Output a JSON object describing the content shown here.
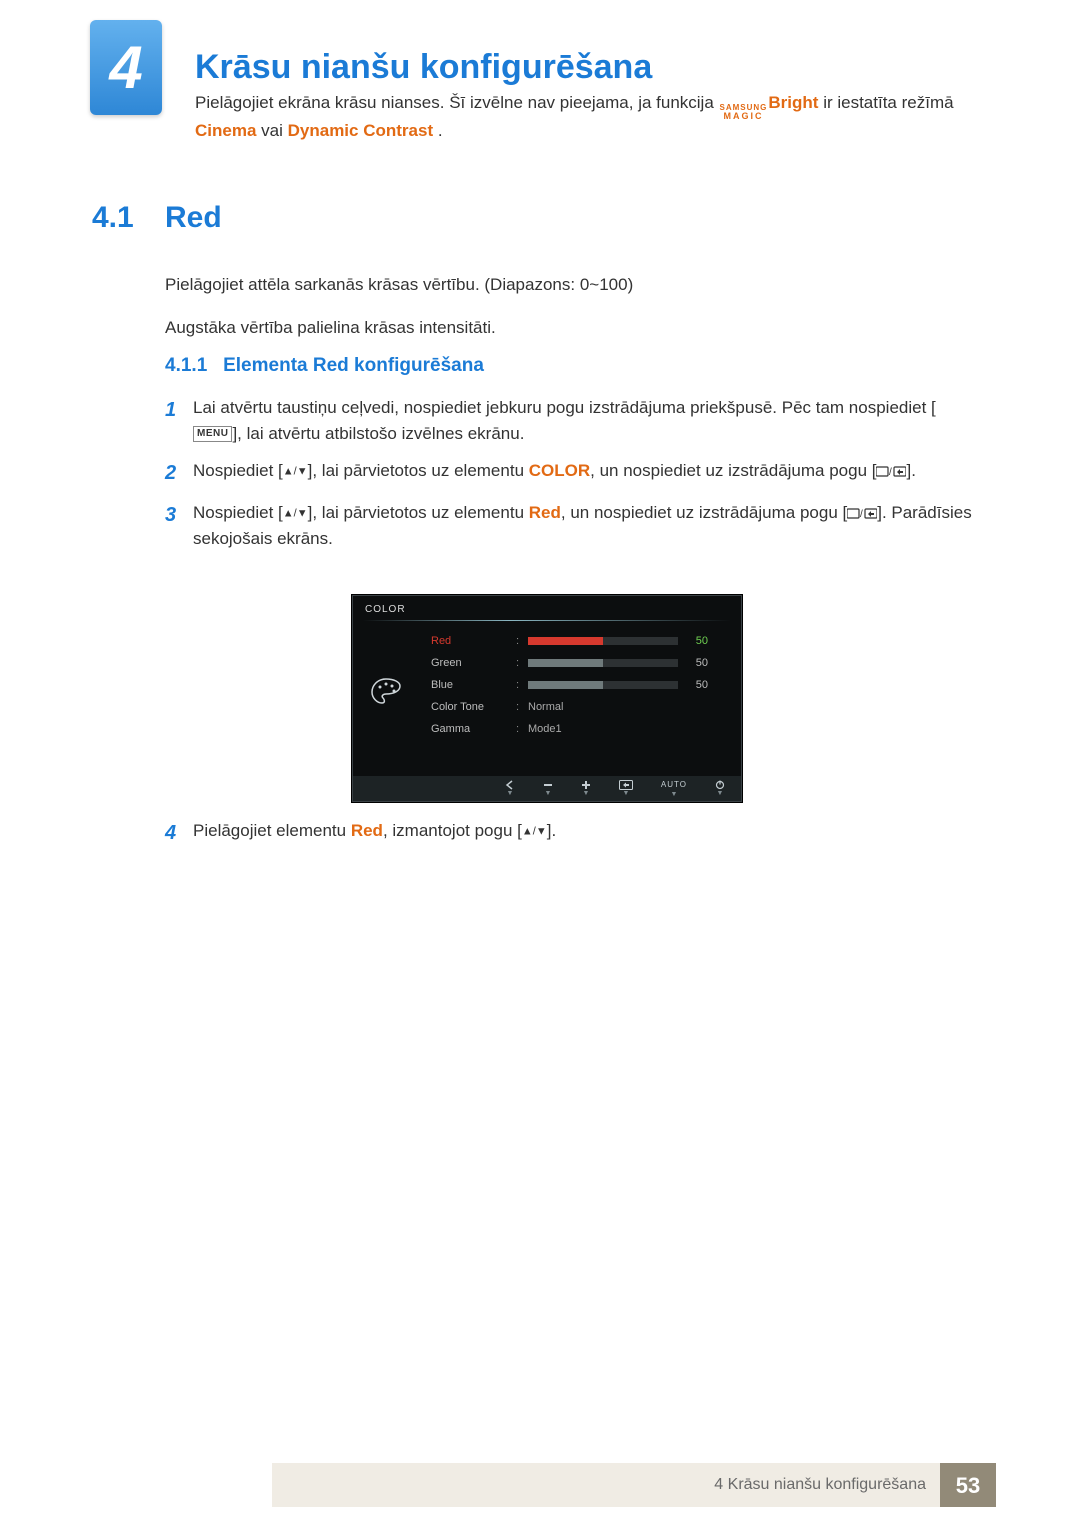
{
  "chapter": {
    "number": "4",
    "title": "Krāsu nianšu konfigurēšana"
  },
  "intro": {
    "p1a": "Pielāgojiet ekrāna krāsu nianses. Šī izvēlne nav pieejama, ja funkcija ",
    "samsung": "SAMSUNG",
    "magic": "MAGIC",
    "bright": "Bright",
    "p1b": " ir iestatīta režīmā ",
    "cinema": "Cinema",
    "or": " vai ",
    "dyn": "Dynamic Contrast",
    "dot": "."
  },
  "section": {
    "num": "4.1",
    "title": "Red"
  },
  "body": {
    "p1": "Pielāgojiet attēla sarkanās krāsas vērtību. (Diapazons: 0~100)",
    "p2": "Augstāka vērtība palielina krāsas intensitāti."
  },
  "subsection": {
    "num": "4.1.1",
    "title": "Elementa Red konfigurēšana"
  },
  "steps": {
    "s1": {
      "n": "1",
      "a": "Lai atvērtu taustiņu ceļvedi, nospiediet jebkuru pogu izstrādājuma priekšpusē. Pēc tam nospiediet [",
      "menu": "MENU",
      "b": "], lai atvērtu atbilstošo izvēlnes ekrānu."
    },
    "s2": {
      "n": "2",
      "a": "Nospiediet [",
      "b": "], lai pārvietotos uz elementu ",
      "color": "COLOR",
      "c": ", un nospiediet uz izstrādājuma pogu [",
      "d": "]."
    },
    "s3": {
      "n": "3",
      "a": "Nospiediet [",
      "b": "], lai pārvietotos uz elementu ",
      "red": "Red",
      "c": ", un nospiediet uz izstrādājuma pogu [",
      "d": "]. Parādīsies sekojošais ekrāns."
    },
    "s4": {
      "n": "4",
      "a": "Pielāgojiet elementu ",
      "red": "Red",
      "b": ", izmantojot pogu [",
      "c": "]."
    }
  },
  "osd": {
    "title": "COLOR",
    "rows": {
      "red": {
        "label": "Red",
        "value": "50",
        "fill": 50,
        "color": "#d6392e"
      },
      "green": {
        "label": "Green",
        "value": "50",
        "fill": 50,
        "color": "#6a726f"
      },
      "blue": {
        "label": "Blue",
        "value": "50",
        "fill": 50,
        "color": "#6a726f"
      },
      "tone": {
        "label": "Color Tone",
        "value": "Normal"
      },
      "gamma": {
        "label": "Gamma",
        "value": "Mode1"
      }
    },
    "bottom": {
      "auto": "AUTO"
    }
  },
  "footer": {
    "text": "4 Krāsu nianšu konfigurēšana",
    "page": "53"
  }
}
